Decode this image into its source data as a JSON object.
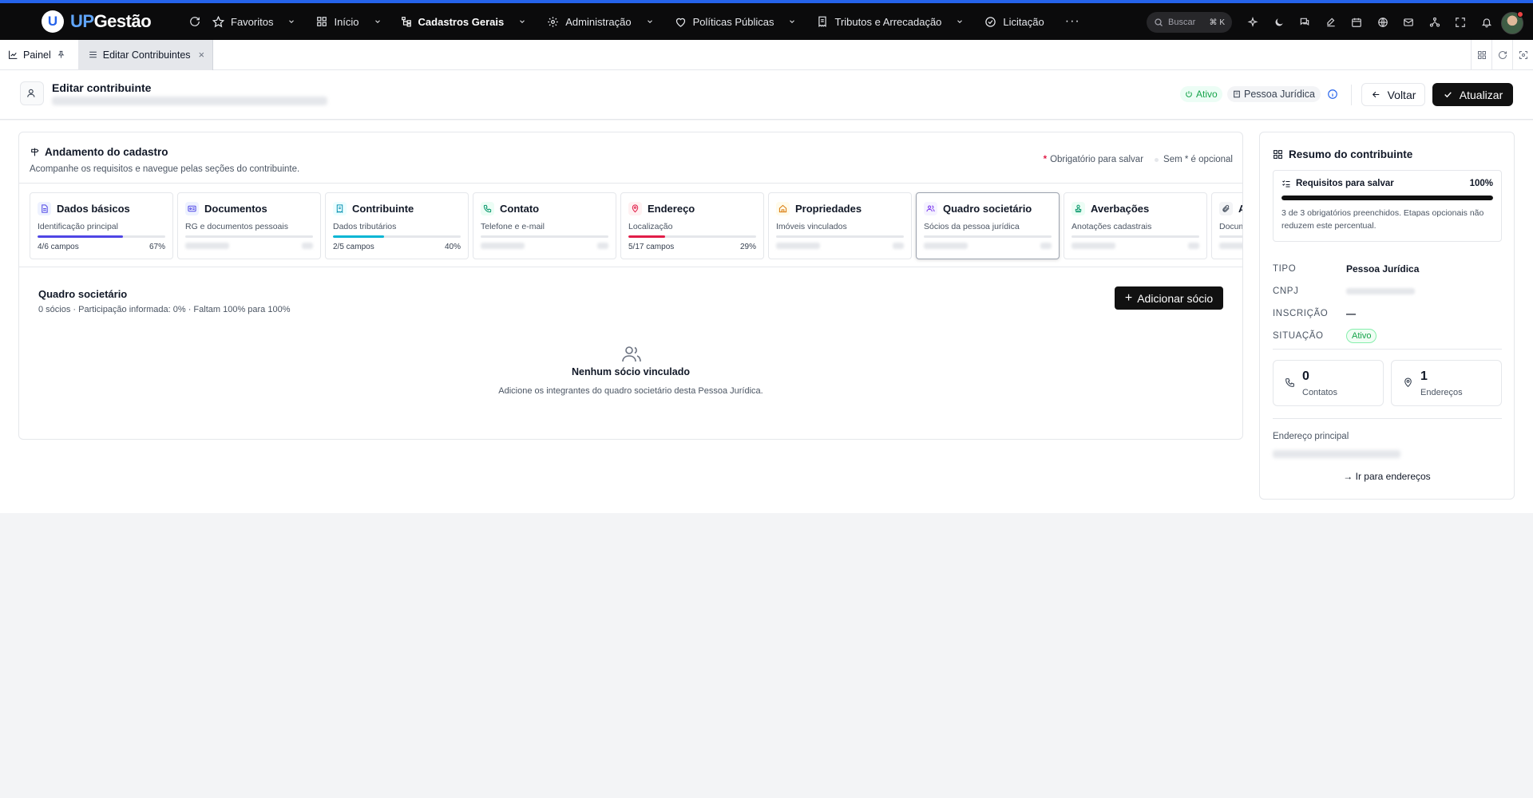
{
  "app": {
    "logo_up": "UP",
    "logo_rest": "Gestão"
  },
  "nav": {
    "items": [
      {
        "label": "Favoritos",
        "icon": "star-icon",
        "chevron": true
      },
      {
        "label": "Início",
        "icon": "grid-icon",
        "chevron": true
      },
      {
        "label": "Cadastros Gerais",
        "icon": "tree-icon",
        "chevron": true,
        "bold": true
      },
      {
        "label": "Administração",
        "icon": "gear-icon",
        "chevron": true
      },
      {
        "label": "Políticas Públicas",
        "icon": "heart-icon",
        "chevron": true
      },
      {
        "label": "Tributos e Arrecadação",
        "icon": "receipt-icon",
        "chevron": true
      },
      {
        "label": "Licitação",
        "icon": "gavel-icon",
        "chevron": false
      }
    ],
    "more": "···",
    "search_placeholder": "Buscar",
    "search_shortcut": "⌘ K"
  },
  "tabs": {
    "painel": "Painel",
    "active": "Editar Contribuintes",
    "close": "×"
  },
  "header": {
    "title": "Editar contribuinte",
    "status": "Ativo",
    "type": "Pessoa Jurídica",
    "back": "Voltar",
    "update": "Atualizar"
  },
  "progress": {
    "title": "Andamento do cadastro",
    "subtitle": "Acompanhe os requisitos e navegue pelas seções do contribuinte.",
    "legend_required": "Obrigatório para salvar",
    "legend_optional": "Sem * é opcional",
    "steps": [
      {
        "name": "Dados básicos",
        "desc": "Identificação principal",
        "fields": "4/6 campos",
        "pct": "67%",
        "fill": 0.67,
        "color": "#4f46e5",
        "icon": "file-icon",
        "icon_bg": "#eef2ff",
        "icon_fg": "#4f46e5"
      },
      {
        "name": "Documentos",
        "desc": "RG e documentos pessoais",
        "fields": "",
        "pct": "",
        "fill": 0,
        "color": "#6366f1",
        "icon": "id-card-icon",
        "icon_bg": "#eef2ff",
        "icon_fg": "#4f46e5"
      },
      {
        "name": "Contribuinte",
        "desc": "Dados tributários",
        "fields": "2/5 campos",
        "pct": "40%",
        "fill": 0.4,
        "color": "#06b6d4",
        "icon": "receipt-icon",
        "icon_bg": "#ecfeff",
        "icon_fg": "#0891b2"
      },
      {
        "name": "Contato",
        "desc": "Telefone e e-mail",
        "fields": "",
        "pct": "",
        "fill": 0,
        "color": "#10b981",
        "icon": "phone-icon",
        "icon_bg": "#ecfdf5",
        "icon_fg": "#059669"
      },
      {
        "name": "Endereço",
        "desc": "Localização",
        "fields": "5/17 campos",
        "pct": "29%",
        "fill": 0.29,
        "color": "#e11d48",
        "icon": "map-pin-icon",
        "icon_bg": "#fff1f2",
        "icon_fg": "#e11d48"
      },
      {
        "name": "Propriedades",
        "desc": "Imóveis vinculados",
        "fields": "",
        "pct": "",
        "fill": 0,
        "color": "#f59e0b",
        "icon": "home-icon",
        "icon_bg": "#fffbeb",
        "icon_fg": "#d97706"
      },
      {
        "name": "Quadro societário",
        "desc": "Sócios da pessoa jurídica",
        "fields": "",
        "pct": "",
        "fill": 0,
        "color": "#8b5cf6",
        "icon": "users-icon",
        "icon_bg": "#f5f3ff",
        "icon_fg": "#7c3aed",
        "active": true
      },
      {
        "name": "Averbações",
        "desc": "Anotações cadastrais",
        "fields": "",
        "pct": "",
        "fill": 0,
        "color": "#10b981",
        "icon": "stamp-icon",
        "icon_bg": "#ecfdf5",
        "icon_fg": "#059669"
      },
      {
        "name": "Anexos",
        "desc": "Documentos anexados",
        "fields": "",
        "pct": "",
        "fill": 0,
        "color": "#6b7280",
        "icon": "paperclip-icon",
        "icon_bg": "#f3f4f6",
        "icon_fg": "#4b5563"
      }
    ]
  },
  "socios": {
    "title": "Quadro societário",
    "subtitle": "0 sócios · Participação informada: 0% · Faltam 100% para 100%",
    "add_button": "Adicionar sócio",
    "empty_title": "Nenhum sócio vinculado",
    "empty_sub": "Adicione os integrantes do quadro societário desta Pessoa Jurídica."
  },
  "summary": {
    "title": "Resumo do contribuinte",
    "req_title": "Requisitos para salvar",
    "req_pct": "100%",
    "req_fill": 1.0,
    "req_note": "3 de 3 obrigatórios preenchidos. Etapas opcionais não reduzem este percentual.",
    "tipo_label": "TIPO",
    "tipo_value": "Pessoa Jurídica",
    "cnpj_label": "CNPJ",
    "inscricao_label": "INSCRIÇÃO",
    "inscricao_value": "—",
    "situacao_label": "SITUAÇÃO",
    "situacao_value": "Ativo",
    "contatos_num": "0",
    "contatos_label": "Contatos",
    "enderecos_num": "1",
    "enderecos_label": "Endereços",
    "endereco_principal": "Endereço principal",
    "go_addresses": "→ Ir para endereços"
  }
}
